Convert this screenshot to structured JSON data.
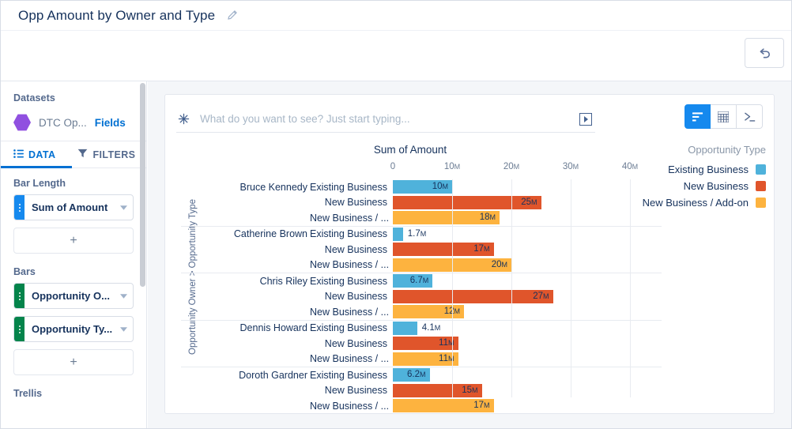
{
  "header": {
    "title": "Opp Amount by Owner and Type",
    "edit_icon": "pencil-icon",
    "undo_icon": "undo-arrow-icon"
  },
  "sidebar": {
    "datasets_label": "Datasets",
    "dataset_name": "DTC Op...",
    "dataset_icon": "hexagon-dataset-icon",
    "fields_link": "Fields",
    "tabs": [
      {
        "label": "DATA",
        "icon": "list-icon",
        "active": true
      },
      {
        "label": "FILTERS",
        "icon": "funnel-icon",
        "active": false
      }
    ],
    "sections": [
      {
        "label": "Bar Length",
        "pills": [
          {
            "text": "Sum of Amount",
            "color": "#1589ee"
          }
        ],
        "add_label": "+"
      },
      {
        "label": "Bars",
        "pills": [
          {
            "text": "Opportunity O...",
            "color": "#04844b"
          },
          {
            "text": "Opportunity Ty...",
            "color": "#04844b"
          }
        ],
        "add_label": "+"
      },
      {
        "label": "Trellis",
        "pills": [],
        "add_label": ""
      }
    ]
  },
  "search": {
    "placeholder": "What do you want to see? Just start typing...",
    "value": "",
    "spark_icon": "sparkle-icon",
    "run_icon": "run-play-icon"
  },
  "view_toggle": [
    {
      "name": "chart-view",
      "icon": "bar-chart-icon",
      "active": true
    },
    {
      "name": "table-view",
      "icon": "grid-table-icon",
      "active": false
    },
    {
      "name": "query-view",
      "icon": "terminal-prompt-icon",
      "active": false
    }
  ],
  "chart_data": {
    "type": "bar",
    "orientation": "horizontal",
    "title": "Sum of Amount",
    "xlabel": "Sum of Amount",
    "ylabel": "Opportunity Owner > Opportunity Type",
    "xlim": [
      0,
      44
    ],
    "xticks": [
      0,
      10,
      20,
      30,
      40
    ],
    "xtick_labels": [
      "0",
      "10M",
      "20M",
      "30M",
      "40M"
    ],
    "unit_suffix": "M",
    "grid": true,
    "legend_title": "Opportunity Type",
    "legend_position": "right",
    "legend": [
      {
        "label": "Existing Business",
        "color": "#4FB2DB"
      },
      {
        "label": "New Business",
        "color": "#E0552B"
      },
      {
        "label": "New Business / Add-on",
        "color": "#FDB33F"
      }
    ],
    "categories": [
      "Existing Business",
      "New Business",
      "New Business / ..."
    ],
    "groups": [
      {
        "owner": "Bruce Kennedy",
        "rows": [
          {
            "type": "Existing Business",
            "value": 10,
            "label": "10M",
            "color": "#4FB2DB",
            "label_inside": true
          },
          {
            "type": "New Business",
            "value": 25,
            "label": "25M",
            "color": "#E0552B",
            "label_inside": true
          },
          {
            "type": "New Business / ...",
            "value": 18,
            "label": "18M",
            "color": "#FDB33F",
            "label_inside": true
          }
        ]
      },
      {
        "owner": "Catherine Brown",
        "rows": [
          {
            "type": "Existing Business",
            "value": 1.7,
            "label": "1.7M",
            "color": "#4FB2DB",
            "label_inside": false
          },
          {
            "type": "New Business",
            "value": 17,
            "label": "17M",
            "color": "#E0552B",
            "label_inside": true
          },
          {
            "type": "New Business / ...",
            "value": 20,
            "label": "20M",
            "color": "#FDB33F",
            "label_inside": true
          }
        ]
      },
      {
        "owner": "Chris Riley",
        "rows": [
          {
            "type": "Existing Business",
            "value": 6.7,
            "label": "6.7M",
            "color": "#4FB2DB",
            "label_inside": true
          },
          {
            "type": "New Business",
            "value": 27,
            "label": "27M",
            "color": "#E0552B",
            "label_inside": true
          },
          {
            "type": "New Business / ...",
            "value": 12,
            "label": "12M",
            "color": "#FDB33F",
            "label_inside": true
          }
        ]
      },
      {
        "owner": "Dennis Howard",
        "rows": [
          {
            "type": "Existing Business",
            "value": 4.1,
            "label": "4.1M",
            "color": "#4FB2DB",
            "label_inside": false
          },
          {
            "type": "New Business",
            "value": 11,
            "label": "11M",
            "color": "#E0552B",
            "label_inside": true
          },
          {
            "type": "New Business / ...",
            "value": 11,
            "label": "11M",
            "color": "#FDB33F",
            "label_inside": true
          }
        ]
      },
      {
        "owner": "Doroth Gardner",
        "rows": [
          {
            "type": "Existing Business",
            "value": 6.2,
            "label": "6.2M",
            "color": "#4FB2DB",
            "label_inside": true
          },
          {
            "type": "New Business",
            "value": 15,
            "label": "15M",
            "color": "#E0552B",
            "label_inside": true
          },
          {
            "type": "New Business / ...",
            "value": 17,
            "label": "17M",
            "color": "#FDB33F",
            "label_inside": true
          }
        ]
      }
    ]
  }
}
